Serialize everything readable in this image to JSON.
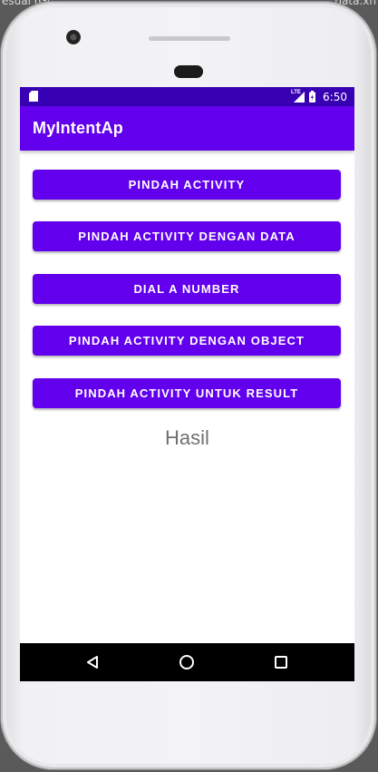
{
  "backdrop": {
    "left_text": "esuai (Gi",
    "right_text": "data.xn"
  },
  "status_bar": {
    "network": "LTE",
    "time": "6:50",
    "background": "#3700b3"
  },
  "app_bar": {
    "title": "MyIntentAp",
    "background": "#6200ee"
  },
  "main": {
    "buttons": [
      {
        "label": "PINDAH ACTIVITY"
      },
      {
        "label": "PINDAH ACTIVITY DENGAN DATA"
      },
      {
        "label": "DIAL A NUMBER"
      },
      {
        "label": "PINDAH ACTIVITY DENGAN OBJECT"
      },
      {
        "label": "PINDAH ACTIVITY UNTUK RESULT"
      }
    ],
    "result_text": "Hasil"
  },
  "nav_bar": {
    "icons": [
      "back-triangle-icon",
      "home-circle-icon",
      "recents-square-icon"
    ]
  },
  "colors": {
    "primary": "#6200ee",
    "primary_dark": "#3700b3",
    "nav": "#000000"
  }
}
